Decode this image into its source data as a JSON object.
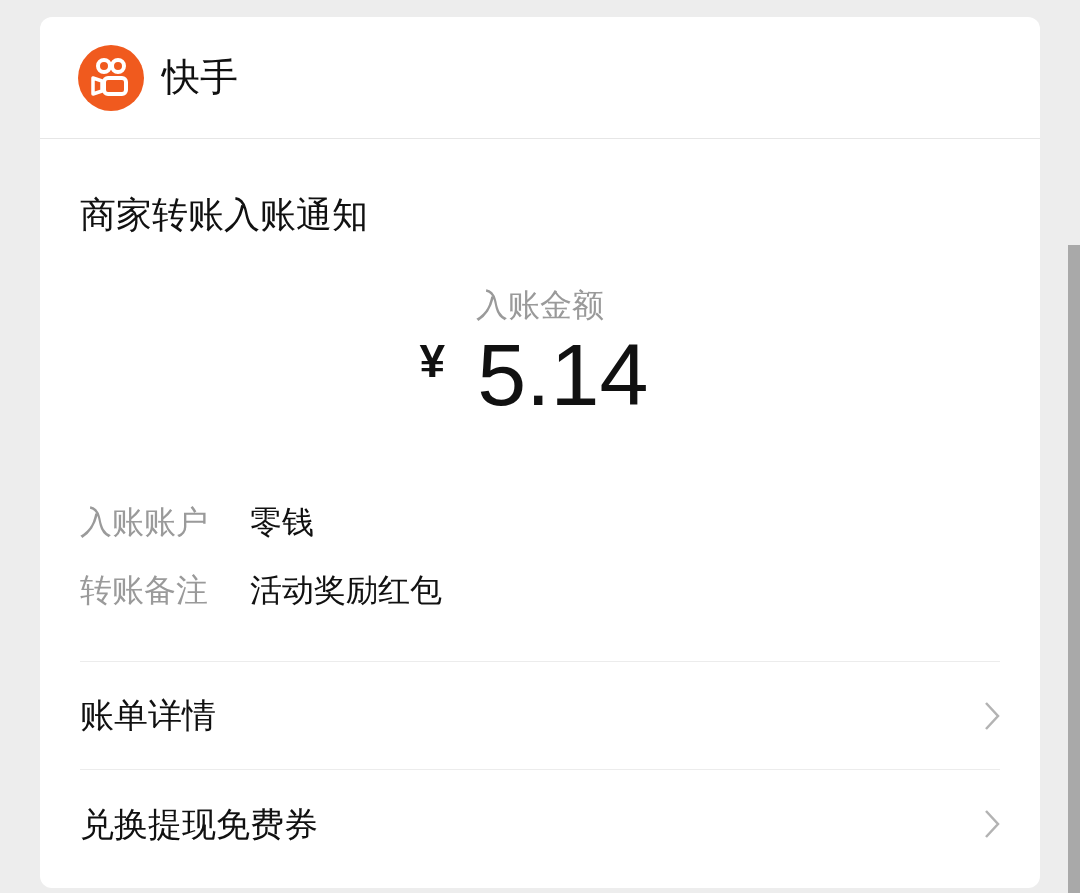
{
  "app": {
    "name": "快手"
  },
  "title": "商家转账入账通知",
  "amount": {
    "label": "入账金额",
    "currency": "¥",
    "value": "5.14"
  },
  "details": [
    {
      "label": "入账账户",
      "value": "零钱"
    },
    {
      "label": "转账备注",
      "value": "活动奖励红包"
    }
  ],
  "links": [
    {
      "label": "账单详情"
    },
    {
      "label": "兑换提现免费券"
    }
  ]
}
